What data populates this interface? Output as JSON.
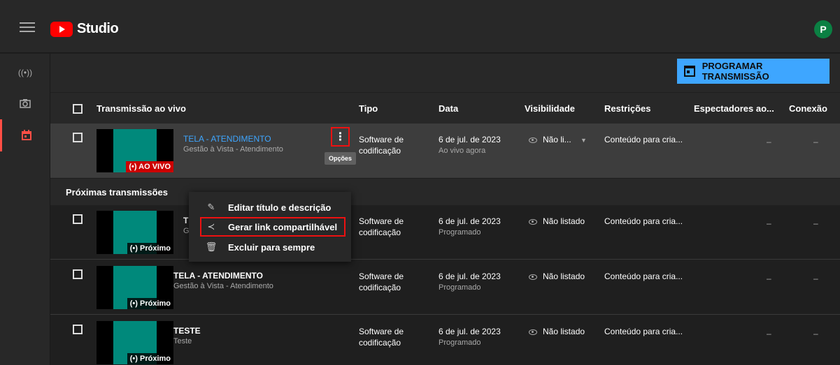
{
  "app": {
    "name": "Studio",
    "avatar_letter": "P"
  },
  "toolbar": {
    "schedule_label": "PROGRAMAR TRANSMISSÃO"
  },
  "columns": [
    "Transmissão ao vivo",
    "Tipo",
    "Data",
    "Visibilidade",
    "Restrições",
    "Espectadores ao...",
    "Conexão"
  ],
  "live_row": {
    "title": "TELA - ATENDIMENTO",
    "description": "Gestão à Vista - Atendimento",
    "badge": "(•) AO VIVO",
    "type_line1": "Software de",
    "type_line2": "codificação",
    "date": "6 de jul. de 2023",
    "date_sub": "Ao vivo agora",
    "visibility": "Não li...",
    "restrictions": "Conteúdo para cria...",
    "viewers": "–",
    "connection": "–",
    "options_tooltip": "Opções"
  },
  "section_title": "Próximas transmissões",
  "upcoming": [
    {
      "title": "TI",
      "description": "Ge",
      "badge": "(•) Próximo",
      "type_line1": "Software de",
      "type_line2": "codificação",
      "date": "6 de jul. de 2023",
      "date_sub": "Programado",
      "visibility": "Não listado",
      "restrictions": "Conteúdo para cria...",
      "viewers": "–",
      "connection": "–"
    },
    {
      "title": "TELA - ATENDIMENTO",
      "description": "Gestão à Vista - Atendimento",
      "badge": "(•) Próximo",
      "type_line1": "Software de",
      "type_line2": "codificação",
      "date": "6 de jul. de 2023",
      "date_sub": "Programado",
      "visibility": "Não listado",
      "restrictions": "Conteúdo para cria...",
      "viewers": "–",
      "connection": "–"
    },
    {
      "title": "TESTE",
      "description": "Teste",
      "badge": "(•) Próximo",
      "type_line1": "Software de",
      "type_line2": "codificação",
      "date": "6 de jul. de 2023",
      "date_sub": "Programado",
      "visibility": "Não listado",
      "restrictions": "Conteúdo para cria...",
      "viewers": "–",
      "connection": "–"
    }
  ],
  "menu": {
    "edit": "Editar título e descrição",
    "share": "Gerar link compartilhável",
    "delete": "Excluir para sempre"
  },
  "sidebar_icons": [
    "live-icon",
    "camera-icon",
    "calendar-icon"
  ]
}
